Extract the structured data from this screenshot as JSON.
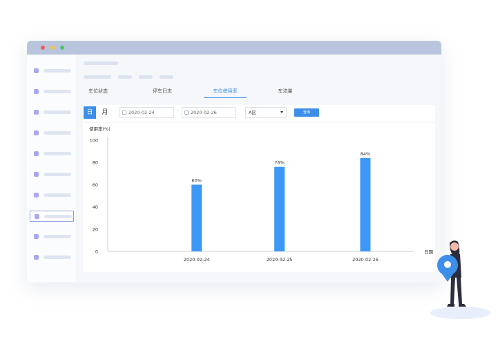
{
  "window": {
    "accent": "#3d8ee8",
    "titlebar_color": "#b9c5dc"
  },
  "sidebar": {
    "item_count": 10,
    "active_index": 7
  },
  "tabs": [
    {
      "label": "车位状态",
      "active": false
    },
    {
      "label": "停车日志",
      "active": false
    },
    {
      "label": "车位使用率",
      "active": true
    },
    {
      "label": "车流量",
      "active": false
    }
  ],
  "filter": {
    "day_label": "日",
    "month_label": "月",
    "start_date": "2020-02-24",
    "separator": "-",
    "end_date": "2020-02-26",
    "select_value": "A区",
    "query_label": "查询"
  },
  "chart_data": {
    "type": "bar",
    "ylabel": "使用率(%)",
    "xlabel": "日期",
    "ylim": [
      0,
      100
    ],
    "yticks": [
      0,
      20,
      40,
      60,
      80,
      100
    ],
    "categories": [
      "2020-02-24",
      "2020-02-25",
      "2020-02-26"
    ],
    "values": [
      60,
      76,
      84
    ],
    "data_labels": [
      "60%",
      "76%",
      "84%"
    ],
    "bar_color": "#3d98f5",
    "grid": false,
    "legend": "none"
  }
}
